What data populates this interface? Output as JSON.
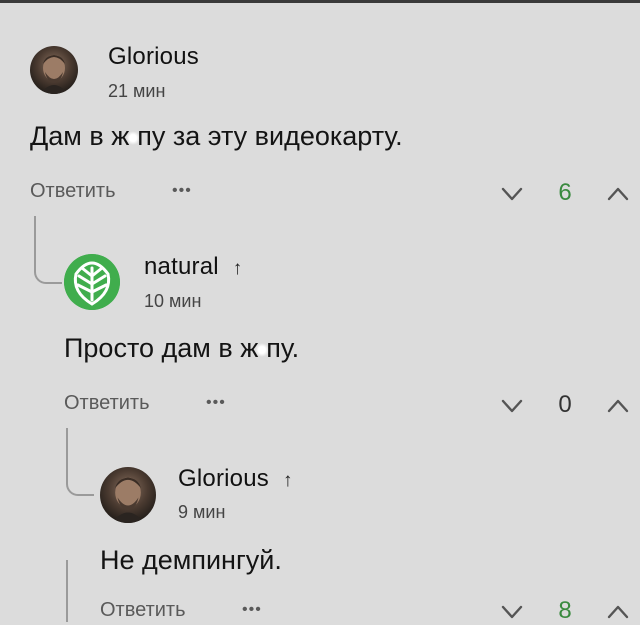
{
  "comments": [
    {
      "author": "Glorious",
      "time": "21 мин",
      "text_before": "Дам в ж",
      "text_after": "пу за эту видеокарту.",
      "reply_label": "Ответить",
      "more_label": "•••",
      "score": "6",
      "score_color": "#3a8a3f"
    },
    {
      "author": "natural",
      "time": "10 мин",
      "text_before": "Просто дам в ж",
      "text_after": "пу.",
      "reply_label": "Ответить",
      "more_label": "•••",
      "score": "0",
      "score_color": "#333333"
    },
    {
      "author": "Glorious",
      "time": "9 мин",
      "text_before": "Не демпингуй.",
      "text_after": "",
      "reply_label": "Ответить",
      "more_label": "•••",
      "score": "8",
      "score_color": "#3a8a3f"
    }
  ],
  "op_marker": "↑",
  "icons": {
    "vote_down": "chevron-down-icon",
    "vote_up": "chevron-up-icon",
    "censor": "asterisk-censor-icon"
  }
}
